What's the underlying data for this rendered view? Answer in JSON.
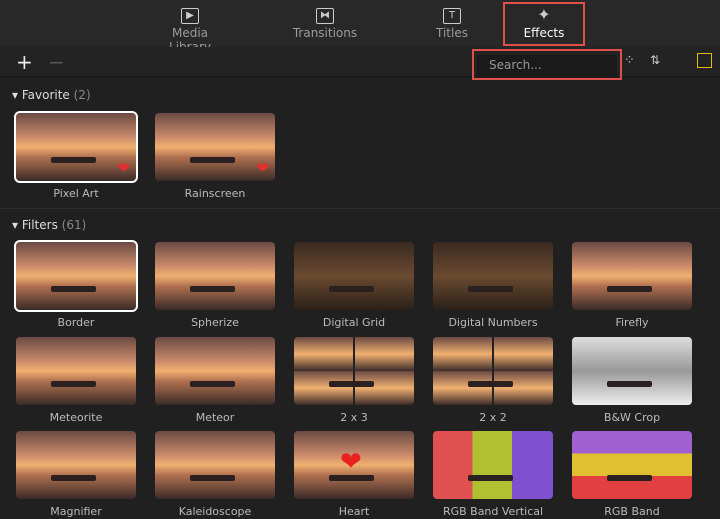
{
  "tabs": [
    {
      "label": "Media Library",
      "icon": "media-library-icon",
      "glyph": "▶"
    },
    {
      "label": "Transitions",
      "icon": "transitions-icon",
      "glyph": "⧓"
    },
    {
      "label": "Titles",
      "icon": "titles-icon",
      "glyph": "T"
    },
    {
      "label": "Effects",
      "icon": "effects-wand-icon",
      "glyph": "✦",
      "active": true
    }
  ],
  "toolbar": {
    "add": "+",
    "remove": "−",
    "search_placeholder": "Search..."
  },
  "favorite": {
    "title": "Favorite",
    "count": "(2)",
    "items": [
      {
        "label": "Pixel Art",
        "selected": true,
        "favorite": true
      },
      {
        "label": "Rainscreen",
        "favorite": true
      }
    ]
  },
  "filters": {
    "title": "Filters",
    "count": "(61)",
    "items": [
      {
        "label": "Border",
        "selected": true
      },
      {
        "label": "Spherize"
      },
      {
        "label": "Digital Grid",
        "style": "grid"
      },
      {
        "label": "Digital Numbers",
        "style": "grid"
      },
      {
        "label": "Firefly"
      },
      {
        "label": "Meteorite"
      },
      {
        "label": "Meteor"
      },
      {
        "label": "2 x 3",
        "style": "split"
      },
      {
        "label": "2 x 2",
        "style": "split"
      },
      {
        "label": "B&W Crop",
        "style": "bw"
      },
      {
        "label": "Magnifier"
      },
      {
        "label": "Kaleidoscope"
      },
      {
        "label": "Heart",
        "style": "heart"
      },
      {
        "label": "RGB Band Vertical",
        "style": "rgbv"
      },
      {
        "label": "RGB Band",
        "style": "rgbh"
      }
    ]
  },
  "colors": {
    "highlight": "#e0504a",
    "accent": "#e8b800"
  }
}
